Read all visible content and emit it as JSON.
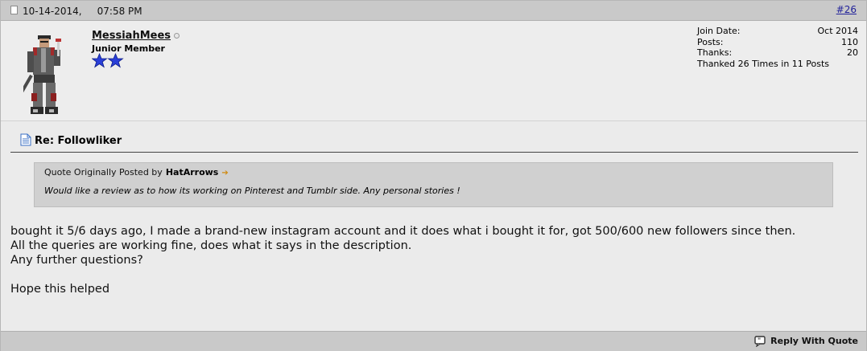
{
  "post": {
    "date": "10-14-2014,",
    "time": "07:58 PM",
    "number": "#26"
  },
  "user": {
    "name": "MessiahMees",
    "title": "Junior Member",
    "stars": 2,
    "star_color": "#2a3fd8"
  },
  "userinfo": {
    "join_label": "Join Date:",
    "join_value": "Oct 2014",
    "posts_label": "Posts:",
    "posts_value": "110",
    "thanks_label": "Thanks:",
    "thanks_value": "20",
    "thanked": "Thanked 26 Times in 11 Posts"
  },
  "message": {
    "title": "Re: Followliker",
    "quote": {
      "prefix": "Quote Originally Posted by",
      "author": "HatArrows",
      "text": "Would like a review as to how its working on Pinterest and Tumblr side. Any personal stories !"
    },
    "body": "bought it 5/6 days ago, I made a brand-new instagram account and it does what i bought it for, got 500/600 new followers since then.\nAll the queries are working fine, does what it says in the description.\nAny further questions?\n\nHope this helped"
  },
  "footer": {
    "reply_label": "Reply With Quote"
  },
  "colors": {
    "header_bg": "#c9c9c9",
    "body_bg": "#ebebeb",
    "quote_bg": "#d0d0d0",
    "link": "#22229a"
  }
}
